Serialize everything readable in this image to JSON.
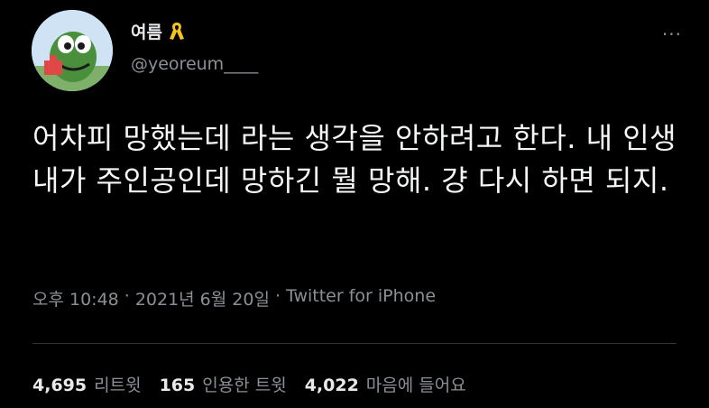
{
  "tweet": {
    "author": {
      "display_name": "여름",
      "badge_icon": "yellow-ribbon-icon",
      "handle": "@yeoreum____"
    },
    "more_icon": "more-options-icon",
    "text": "어차피 망했는데 라는 생각을 안하려고 한다. 내 인생 내가 주인공인데 망하긴 뭘 망해. 걍 다시 하면 되지.",
    "time": "오후 10:48",
    "separator": "·",
    "date": "2021년 6월 20일",
    "source": "Twitter for iPhone",
    "stats": [
      {
        "count": "4,695",
        "label": "리트윗"
      },
      {
        "count": "165",
        "label": "인용한 트윗"
      },
      {
        "count": "4,022",
        "label": "마음에 들어요"
      }
    ]
  },
  "colors": {
    "background": "#000000",
    "text_primary": "#e7e9ea",
    "text_secondary": "#8b9096",
    "ribbon": "#f5c518",
    "divider": "#2f3336"
  }
}
